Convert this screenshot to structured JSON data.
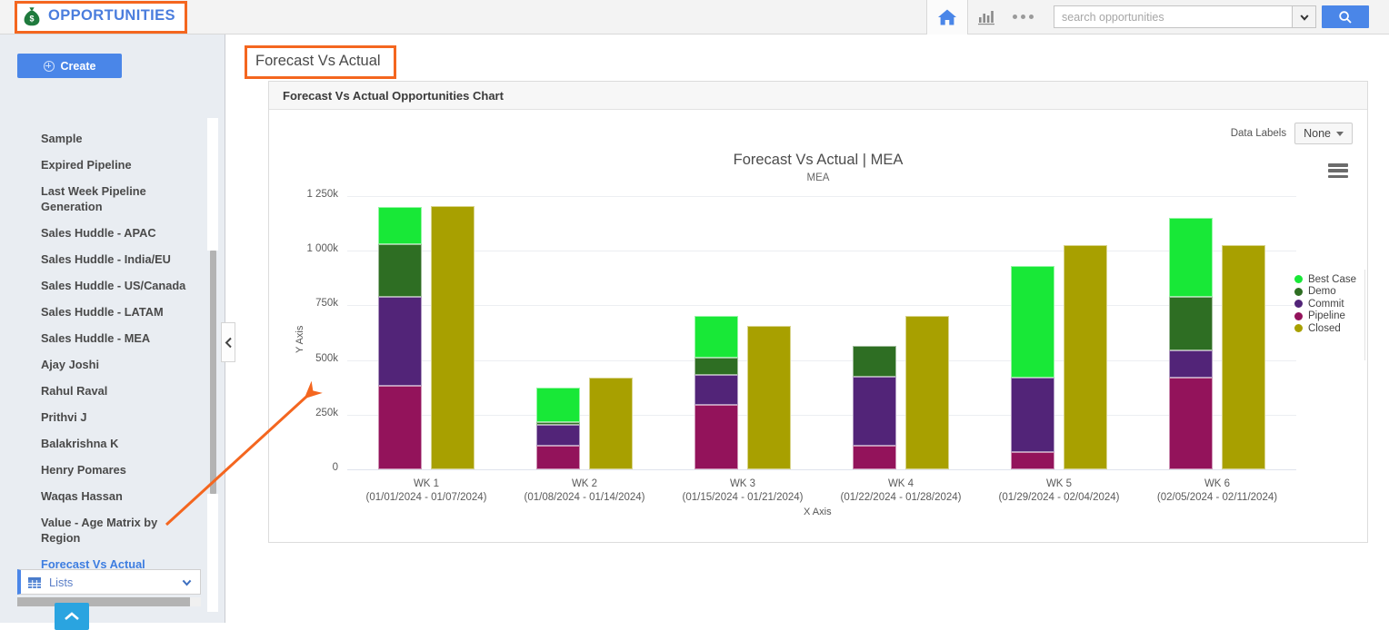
{
  "header": {
    "brand_title": "OPPORTUNITIES",
    "brand_icon": "money-bag-icon",
    "home_icon": "home-icon",
    "reports_icon": "bar-chart-icon",
    "more_icon": "ellipsis-icon",
    "search_placeholder": "search opportunities",
    "search_value": "",
    "search_caret_icon": "chevron-down-icon",
    "search_button_icon": "magnifier-icon"
  },
  "sidebar": {
    "create_label": "Create",
    "create_icon": "plus-circle-icon",
    "items": [
      {
        "label": "Sample",
        "active": false
      },
      {
        "label": "Expired Pipeline",
        "active": false
      },
      {
        "label": "Last Week Pipeline Generation",
        "active": false
      },
      {
        "label": "Sales Huddle - APAC",
        "active": false
      },
      {
        "label": "Sales Huddle - India/EU",
        "active": false
      },
      {
        "label": "Sales Huddle - US/Canada",
        "active": false
      },
      {
        "label": "Sales Huddle - LATAM",
        "active": false
      },
      {
        "label": "Sales Huddle - MEA",
        "active": false
      },
      {
        "label": "Ajay Joshi",
        "active": false
      },
      {
        "label": "Rahul Raval",
        "active": false
      },
      {
        "label": "Prithvi J",
        "active": false
      },
      {
        "label": "Balakrishna K",
        "active": false
      },
      {
        "label": "Henry Pomares",
        "active": false
      },
      {
        "label": "Waqas Hassan",
        "active": false
      },
      {
        "label": "Value - Age Matrix by Region",
        "active": false
      },
      {
        "label": "Forecast Vs Actual",
        "active": true
      }
    ],
    "lists_label": "Lists",
    "lists_icon": "grid-icon",
    "lists_caret_icon": "chevron-down-icon",
    "collapse_icon": "chevron-left-icon",
    "scroll_up_icon": "chevron-up-icon"
  },
  "main": {
    "page_title": "Forecast Vs Actual",
    "card_title": "Forecast Vs Actual Opportunities Chart",
    "data_labels_text": "Data Labels",
    "data_labels_value": "None",
    "data_labels_caret_icon": "caret-down-icon",
    "menu_icon": "hamburger-menu-icon"
  },
  "colors": {
    "best_case": "#18e837",
    "demo": "#2e6e23",
    "commit": "#522478",
    "pipeline": "#93135b",
    "closed": "#a8a000",
    "accent_blue": "#4a86e8",
    "highlight_orange": "#f4661f",
    "active_link": "#3d7de0"
  },
  "chart_data": {
    "type": "bar",
    "title": "Forecast Vs Actual | MEA",
    "subtitle": "MEA",
    "xlabel": "X Axis",
    "ylabel": "Y Axis",
    "ylim": [
      0,
      1250000
    ],
    "yticks": [
      0,
      250000,
      500000,
      750000,
      1000000,
      1250000
    ],
    "ytick_labels": [
      "0",
      "250k",
      "500k",
      "750k",
      "1 000k",
      "1 250k"
    ],
    "grid": true,
    "legend_position": "right",
    "stacked": true,
    "categories": [
      "WK 1\n(01/01/2024 - 01/07/2024)",
      "WK 2\n(01/08/2024 - 01/14/2024)",
      "WK 3\n(01/15/2024 - 01/21/2024)",
      "WK 4\n(01/22/2024 - 01/28/2024)",
      "WK 5\n(01/29/2024 - 02/04/2024)",
      "WK 6\n(02/05/2024 - 02/11/2024)"
    ],
    "category_labels": [
      {
        "week": "WK 1",
        "range": "(01/01/2024 - 01/07/2024)"
      },
      {
        "week": "WK 2",
        "range": "(01/08/2024 - 01/14/2024)"
      },
      {
        "week": "WK 3",
        "range": "(01/15/2024 - 01/21/2024)"
      },
      {
        "week": "WK 4",
        "range": "(01/22/2024 - 01/28/2024)"
      },
      {
        "week": "WK 5",
        "range": "(01/29/2024 - 02/04/2024)"
      },
      {
        "week": "WK 6",
        "range": "(02/05/2024 - 02/11/2024)"
      }
    ],
    "series": [
      {
        "name": "Best Case",
        "color": "#18e837",
        "stack": "forecast",
        "values": [
          170000,
          160000,
          190000,
          0,
          510000,
          360000
        ]
      },
      {
        "name": "Demo",
        "color": "#2e6e23",
        "stack": "forecast",
        "values": [
          240000,
          10000,
          80000,
          140000,
          0,
          245000
        ]
      },
      {
        "name": "Commit",
        "color": "#522478",
        "stack": "forecast",
        "values": [
          410000,
          95000,
          135000,
          315000,
          340000,
          125000
        ]
      },
      {
        "name": "Pipeline",
        "color": "#93135b",
        "stack": "forecast",
        "values": [
          380000,
          110000,
          295000,
          110000,
          80000,
          420000
        ]
      },
      {
        "name": "Closed",
        "color": "#a8a000",
        "stack": "actual",
        "values": [
          1205000,
          420000,
          655000,
          700000,
          1025000,
          1025000
        ]
      }
    ],
    "stack_totals": {
      "forecast": [
        1200000,
        375000,
        700000,
        565000,
        930000,
        1150000
      ],
      "actual": [
        1205000,
        420000,
        655000,
        700000,
        1025000,
        1025000
      ]
    }
  }
}
